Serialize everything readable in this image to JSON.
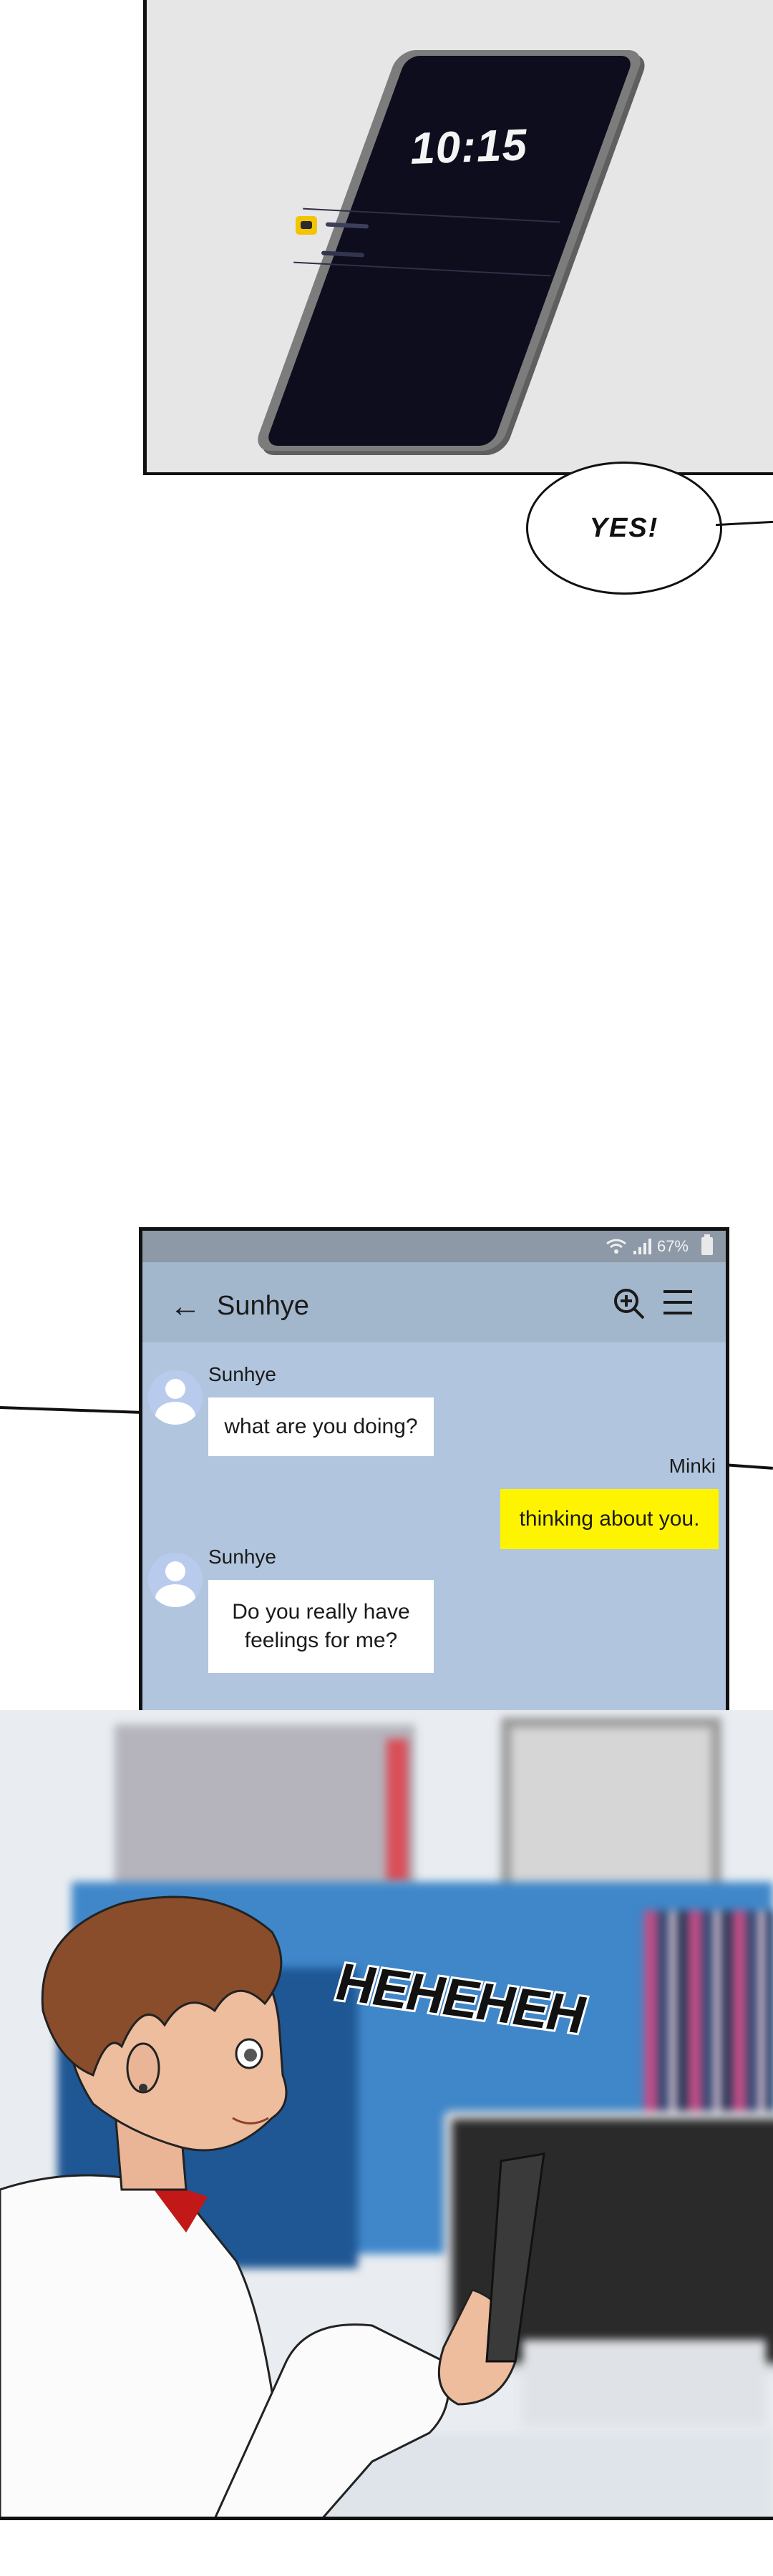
{
  "panel_phone": {
    "lock_time": "10:15"
  },
  "speech_bubble": {
    "text": "YES!"
  },
  "chat": {
    "status": {
      "battery": "67%"
    },
    "header": {
      "back_glyph": "←",
      "contact_name": "Sunhye",
      "icons": [
        "back-arrow-icon",
        "zoom-in-icon",
        "menu-icon"
      ]
    },
    "messages": [
      {
        "sender": "Sunhye",
        "text": "what are you doing?",
        "direction": "incoming"
      },
      {
        "sender": "Minki",
        "text": "thinking about you.",
        "direction": "outgoing"
      },
      {
        "sender": "Sunhye",
        "text": "Do you really have feelings for me?",
        "direction": "incoming"
      }
    ],
    "colors": {
      "chat_background": "#b1c6de",
      "outgoing_bubble": "#fff400",
      "incoming_bubble": "#ffffff"
    }
  },
  "sound_effect": {
    "text": "HEHEHEH"
  }
}
